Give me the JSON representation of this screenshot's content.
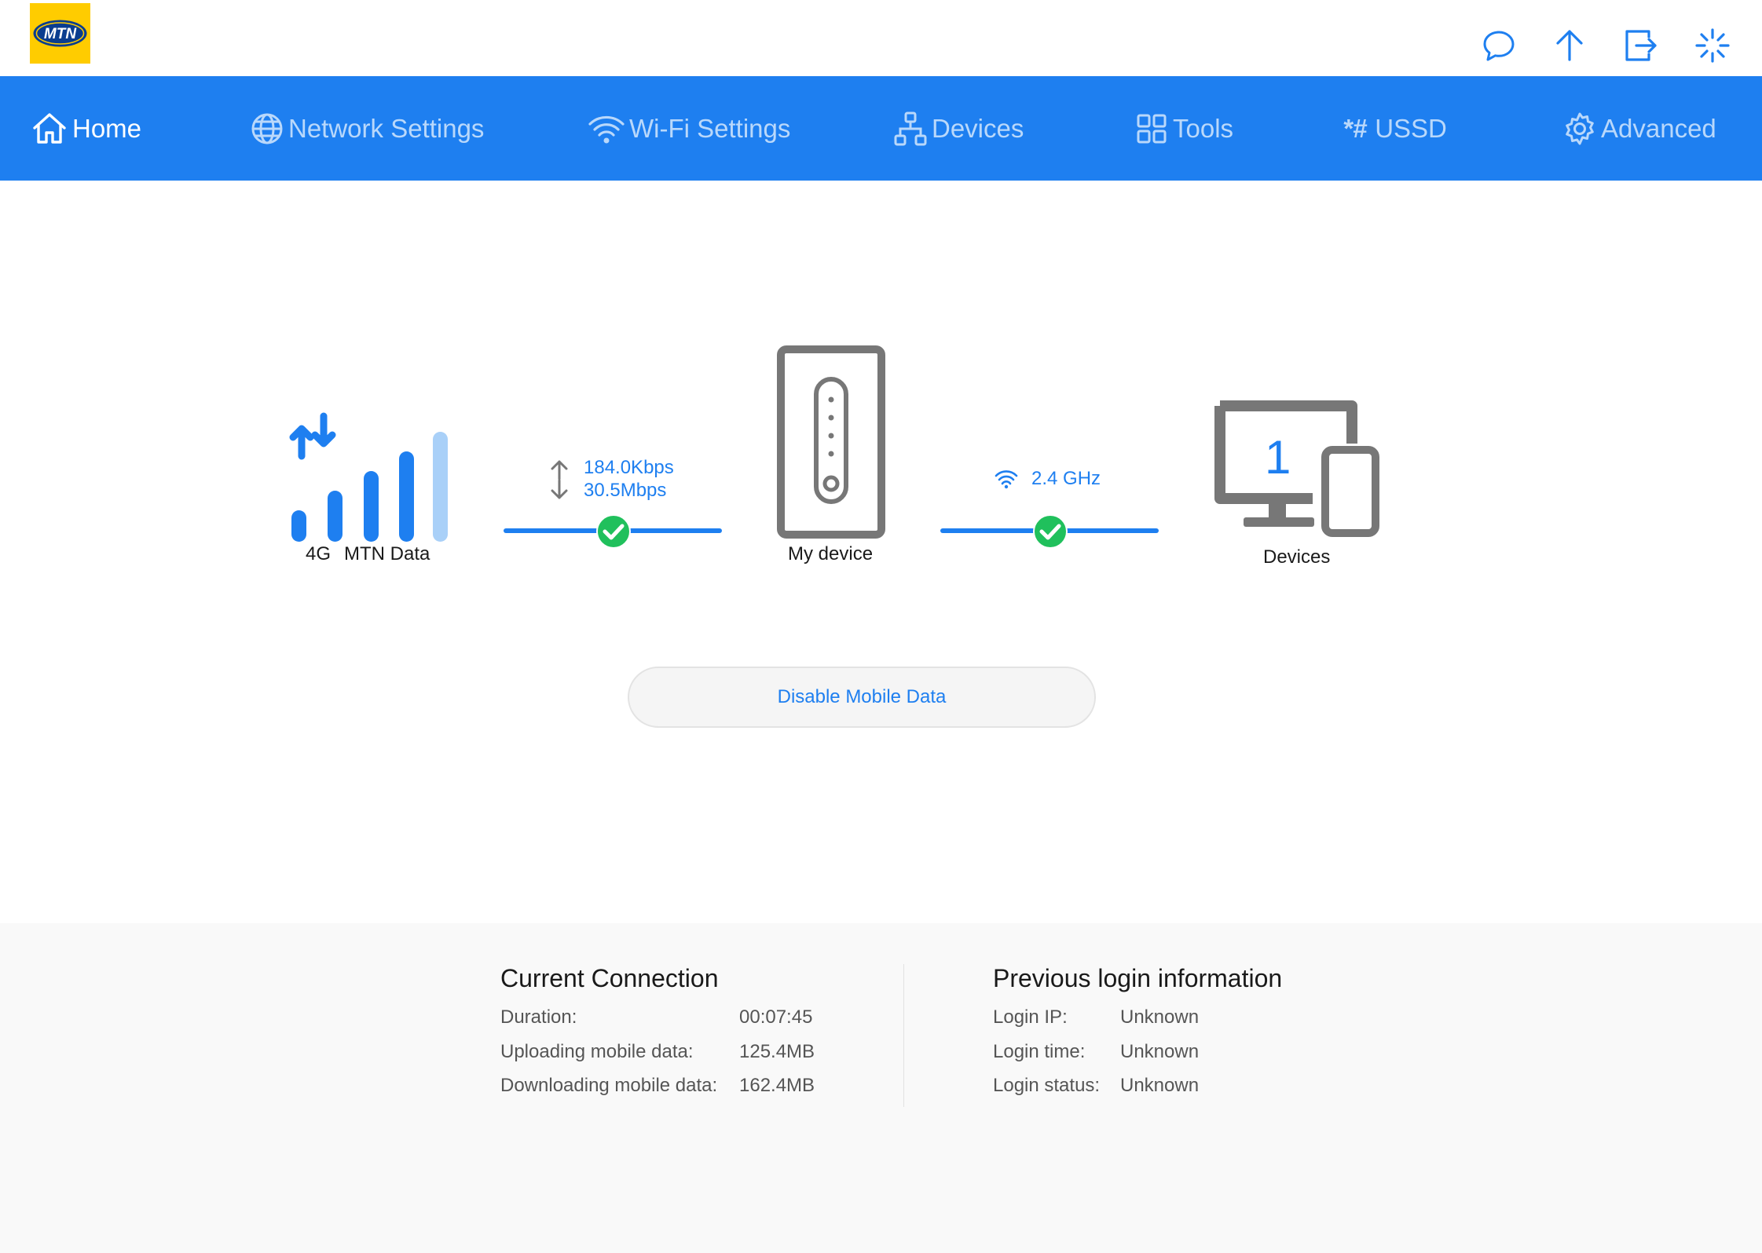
{
  "header": {
    "logo_text": "MTN",
    "icons": [
      "message-icon",
      "upload-arrow-icon",
      "logout-icon",
      "loading-spinner-icon"
    ]
  },
  "nav": {
    "items": [
      {
        "label": "Home",
        "icon": "home-icon",
        "active": true
      },
      {
        "label": "Network Settings",
        "icon": "globe-icon",
        "active": false
      },
      {
        "label": "Wi-Fi Settings",
        "icon": "wifi-icon",
        "active": false
      },
      {
        "label": "Devices",
        "icon": "network-topology-icon",
        "active": false
      },
      {
        "label": "Tools",
        "icon": "grid-icon",
        "active": false
      },
      {
        "label": "USSD",
        "icon": "ussd-icon",
        "icon_text": "*#",
        "active": false
      },
      {
        "label": "Advanced",
        "icon": "gear-icon",
        "active": false
      }
    ]
  },
  "status": {
    "network_type": "4G",
    "operator": "MTN Data",
    "upload_rate": "184.0Kbps",
    "download_rate": "30.5Mbps",
    "router_label": "My device",
    "wifi_band": "2.4 GHz",
    "device_count": "1",
    "devices_label": "Devices",
    "signal_bars_active": 4,
    "signal_bars_total": 5
  },
  "actions": {
    "disable_mobile_data": "Disable Mobile Data"
  },
  "current_connection": {
    "title": "Current Connection",
    "rows": [
      {
        "key": "Duration:",
        "value": "00:07:45"
      },
      {
        "key": "Uploading mobile data:",
        "value": "125.4MB"
      },
      {
        "key": "Downloading mobile data:",
        "value": "162.4MB"
      }
    ]
  },
  "previous_login": {
    "title": "Previous login information",
    "rows": [
      {
        "key": "Login IP:",
        "value": "Unknown"
      },
      {
        "key": "Login time:",
        "value": "Unknown"
      },
      {
        "key": "Login status:",
        "value": "Unknown"
      }
    ]
  },
  "colors": {
    "brand_blue": "#1e7ff0",
    "brand_yellow": "#ffcc00",
    "success_green": "#20c05c",
    "device_gray": "#777777",
    "inactive_bar": "#a9d0f8"
  }
}
